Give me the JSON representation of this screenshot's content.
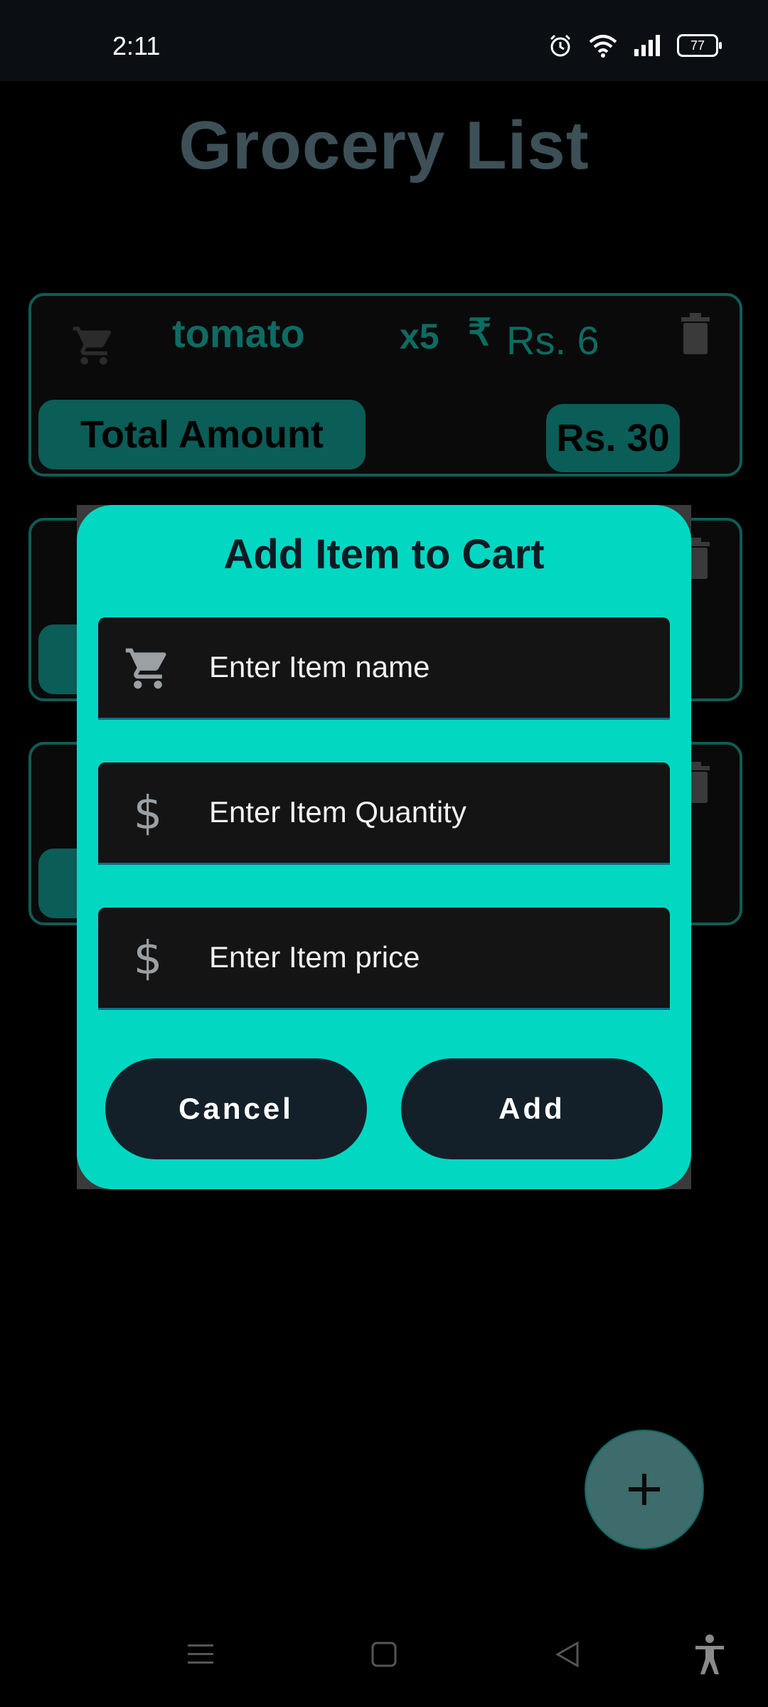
{
  "status_bar": {
    "time": "2:11",
    "battery": "77"
  },
  "app": {
    "title": "Grocery List"
  },
  "cards": [
    {
      "item_name": "tomato",
      "quantity": "x5",
      "currency_symbol": "₹",
      "price": "Rs. 6",
      "total_label": "Total Amount",
      "total_value": "Rs. 30"
    }
  ],
  "dialog": {
    "title": "Add Item to Cart",
    "fields": [
      {
        "placeholder": "Enter Item name",
        "icon": "cart-icon"
      },
      {
        "placeholder": "Enter Item Quantity",
        "icon": "dollar-icon"
      },
      {
        "placeholder": "Enter Item price",
        "icon": "dollar-icon"
      }
    ],
    "dollar_glyph": "$",
    "cancel_label": "Cancel",
    "add_label": "Add"
  },
  "colors": {
    "dialog_bg": "#02d7c2",
    "card_border": "#0f5c56",
    "button_bg": "#132029",
    "title": "#3d5057"
  }
}
